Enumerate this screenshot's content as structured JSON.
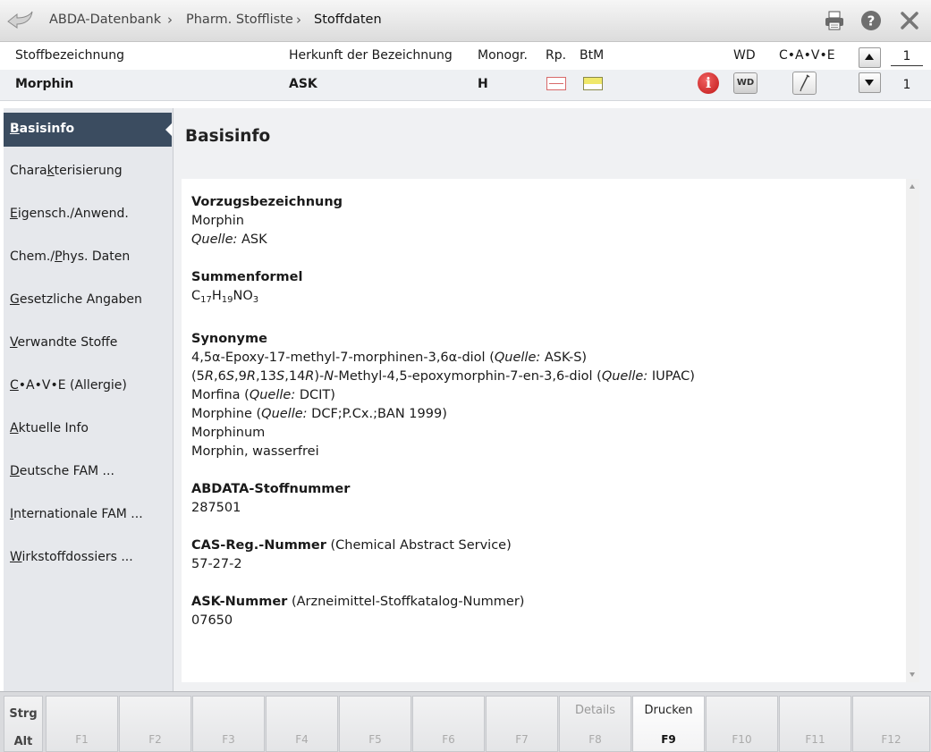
{
  "breadcrumb": [
    "ABDA-Datenbank",
    "Pharm. Stoffliste",
    "Stoffdaten"
  ],
  "header": {
    "col_name": "Stoffbezeichnung",
    "col_origin": "Herkunft der Bezeichnung",
    "col_monogr": "Monogr.",
    "col_rp": "Rp.",
    "col_btm": "BtM",
    "col_wd": "WD",
    "col_cave": "C•A•V•E",
    "page_top": "1",
    "page_bottom": "1"
  },
  "record": {
    "name": "Morphin",
    "origin": "ASK",
    "monogr": "H",
    "wd_label": "WD",
    "info_label": "i"
  },
  "sidebar": {
    "items": [
      {
        "pre": "",
        "ul": "B",
        "post": "asisinfo"
      },
      {
        "pre": "Chara",
        "ul": "k",
        "post": "terisierung"
      },
      {
        "pre": "",
        "ul": "E",
        "post": "igensch./Anwend."
      },
      {
        "pre": "Chem./",
        "ul": "P",
        "post": "hys. Daten"
      },
      {
        "pre": "",
        "ul": "G",
        "post": "esetzliche Angaben"
      },
      {
        "pre": "",
        "ul": "V",
        "post": "erwandte Stoffe"
      },
      {
        "pre": "",
        "ul": "C",
        "post": "•A•V•E (Allergie)"
      },
      {
        "pre": "",
        "ul": "A",
        "post": "ktuelle Info"
      },
      {
        "pre": "",
        "ul": "D",
        "post": "eutsche FAM ..."
      },
      {
        "pre": "",
        "ul": "I",
        "post": "nternationale FAM ..."
      },
      {
        "pre": "",
        "ul": "W",
        "post": "irkstoffdossiers ..."
      }
    ]
  },
  "content": {
    "title": "Basisinfo",
    "quelle_label": "Quelle:",
    "vorzug": {
      "heading": "Vorzugsbezeichnung",
      "value": "Morphin",
      "source": "ASK"
    },
    "formel": {
      "heading": "Summenformel",
      "c": "C",
      "c_n": "17",
      "h": "H",
      "h_n": "19",
      "no": "NO",
      "o_n": "3"
    },
    "synonyme": {
      "heading": "Synonyme",
      "s1": {
        "text": "4,5α-Epoxy-17-methyl-7-morphinen-3,6α-diol (",
        "source": "ASK-S)"
      },
      "s2": {
        "p1": "(5",
        "r1": "R",
        "p2": ",6",
        "s1": "S",
        "p3": ",9",
        "r2": "R",
        "p4": ",13",
        "s2": "S",
        "p5": ",14",
        "r3": "R",
        "p6": ")-",
        "n": "N",
        "p7": "-Methyl-4,5-epoxymorphin-7-en-3,6-diol (",
        "source": "IUPAC)"
      },
      "s3": {
        "text": "Morfina (",
        "source": "DCIT)"
      },
      "s4": {
        "text": "Morphine (",
        "source": "DCF;P.Cx.;BAN 1999)"
      },
      "s5": "Morphinum",
      "s6": "Morphin, wasserfrei"
    },
    "abdata": {
      "heading": "ABDATA-Stoffnummer",
      "value": "287501"
    },
    "cas": {
      "heading": "CAS-Reg.-Nummer",
      "note": "(Chemical Abstract Service)",
      "value": "57-27-2"
    },
    "ask": {
      "heading": "ASK-Nummer",
      "note": "(Arzneimittel-Stoffkatalog-Nummer)",
      "value": "07650"
    }
  },
  "footer": {
    "mod1": "Strg",
    "mod2": "Alt",
    "keys": [
      {
        "label": "",
        "key": "F1"
      },
      {
        "label": "",
        "key": "F2"
      },
      {
        "label": "",
        "key": "F3"
      },
      {
        "label": "",
        "key": "F4"
      },
      {
        "label": "",
        "key": "F5"
      },
      {
        "label": "",
        "key": "F6"
      },
      {
        "label": "",
        "key": "F7"
      },
      {
        "label": "Details",
        "key": "F8"
      },
      {
        "label": "Drucken",
        "key": "F9"
      },
      {
        "label": "",
        "key": "F10"
      },
      {
        "label": "",
        "key": "F11"
      },
      {
        "label": "",
        "key": "F12"
      }
    ]
  },
  "colors": {
    "active_nav": "#3b4c60",
    "info_red": "#c01818",
    "sidebar_bg": "#e6e8ec"
  }
}
